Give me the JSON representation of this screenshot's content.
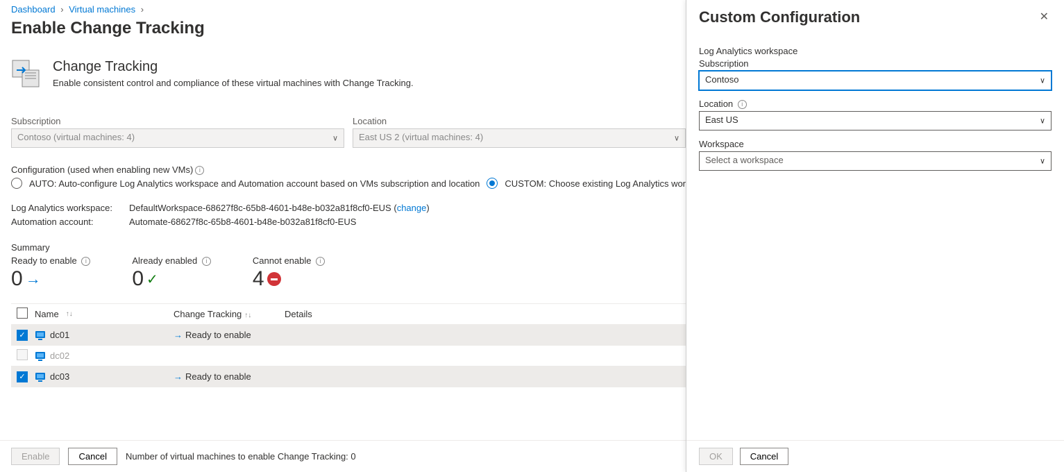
{
  "breadcrumb": {
    "dashboard": "Dashboard",
    "vms": "Virtual machines"
  },
  "page_title": "Enable Change Tracking",
  "feature": {
    "title": "Change Tracking",
    "desc": "Enable consistent control and compliance of these virtual machines with Change Tracking."
  },
  "filters": {
    "subscription_label": "Subscription",
    "subscription_value": "Contoso (virtual machines: 4)",
    "location_label": "Location",
    "location_value": "East US 2 (virtual machines: 4)"
  },
  "config": {
    "label": "Configuration (used when enabling new VMs)",
    "auto_label": "AUTO: Auto-configure Log Analytics workspace and Automation account based on VMs subscription and location",
    "custom_label": "CUSTOM: Choose existing Log Analytics workspa"
  },
  "details": {
    "law_label": "Log Analytics workspace:",
    "law_value": "DefaultWorkspace-68627f8c-65b8-4601-b48e-b032a81f8cf0-EUS",
    "law_change": "change",
    "auto_label": "Automation account:",
    "auto_value": "Automate-68627f8c-65b8-4601-b48e-b032a81f8cf0-EUS"
  },
  "summary": {
    "title": "Summary",
    "ready_label": "Ready to enable",
    "ready_value": "0",
    "already_label": "Already enabled",
    "already_value": "0",
    "cannot_label": "Cannot enable",
    "cannot_value": "4"
  },
  "table": {
    "headers": {
      "name": "Name",
      "ct": "Change Tracking",
      "details": "Details"
    },
    "rows": [
      {
        "checked": true,
        "name": "dc01",
        "status": "Ready to enable",
        "dim": false
      },
      {
        "checked": false,
        "name": "dc02",
        "status": "",
        "dim": true
      },
      {
        "checked": true,
        "name": "dc03",
        "status": "Ready to enable",
        "dim": false
      }
    ]
  },
  "footer": {
    "enable": "Enable",
    "cancel": "Cancel",
    "count_text": "Number of virtual machines to enable Change Tracking: 0"
  },
  "panel": {
    "title": "Custom Configuration",
    "law_section": "Log Analytics workspace",
    "subscription_label": "Subscription",
    "subscription_value": "Contoso",
    "location_label": "Location",
    "location_value": "East US",
    "workspace_label": "Workspace",
    "workspace_placeholder": "Select a workspace",
    "ok": "OK",
    "cancel": "Cancel"
  }
}
